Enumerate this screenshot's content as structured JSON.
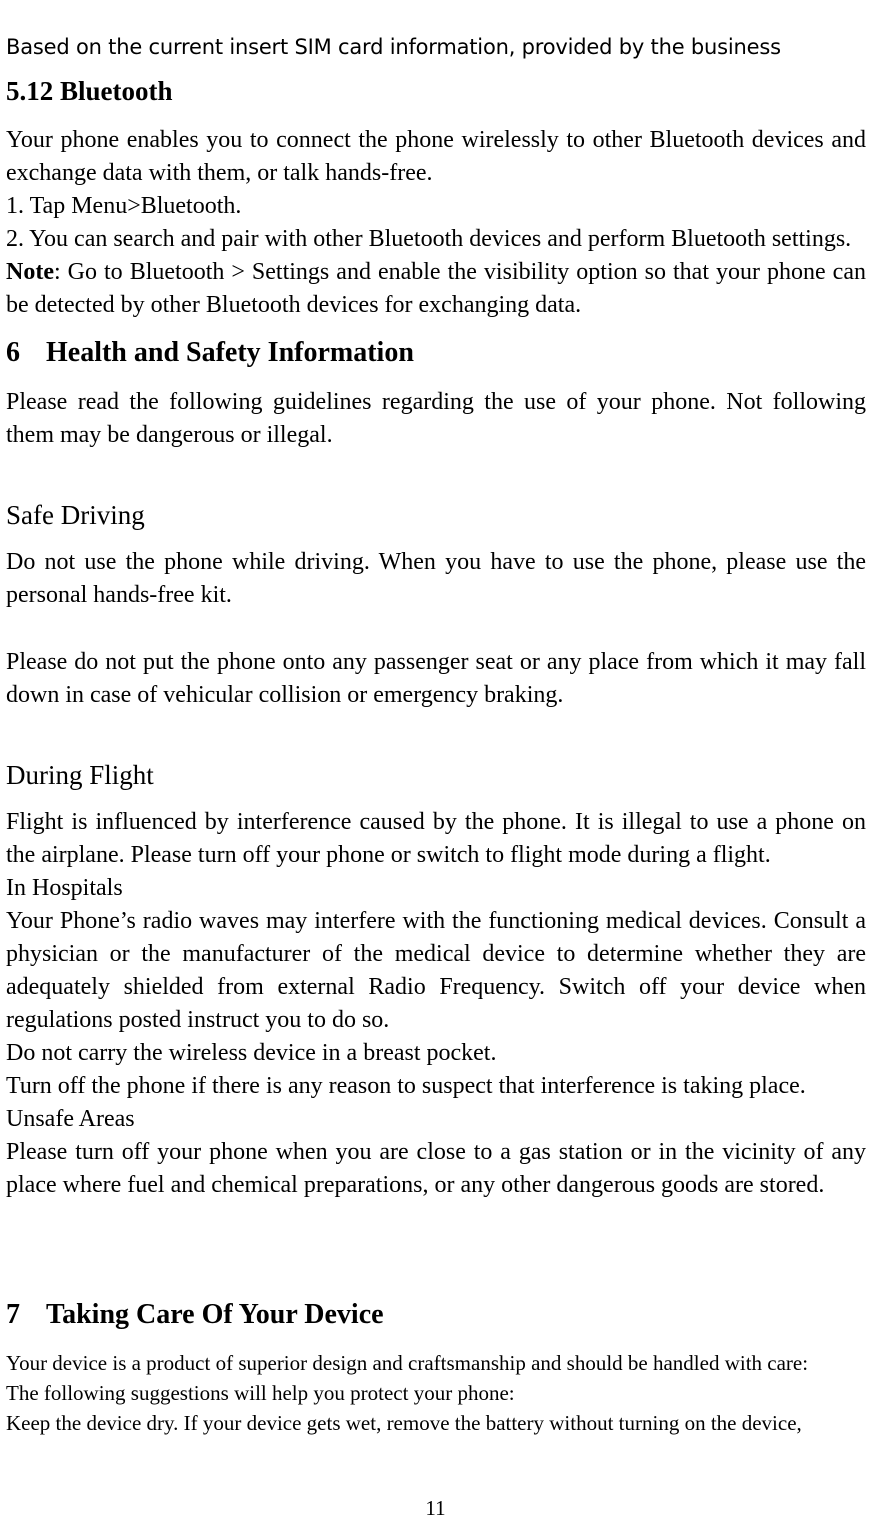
{
  "document": {
    "page_number": "11",
    "running_header": "Based on the current insert SIM card information, provided by the business"
  },
  "bluetooth_section": {
    "heading": "5.12 Bluetooth",
    "intro": "Your phone enables you to connect the phone wirelessly to other Bluetooth devices and exchange data with them, or talk hands-free.",
    "steps": [
      "1. Tap Menu>Bluetooth.",
      "2. You can search and pair with other Bluetooth devices and perform Bluetooth settings."
    ],
    "note_label": "Note",
    "note_text": ": Go to Bluetooth > Settings and enable the visibility option so that your phone can be detected by other Bluetooth devices for exchanging data."
  },
  "health_section": {
    "number": "6",
    "title": "Health and Safety Information",
    "intro": "Please read the following guidelines regarding the use of your phone. Not following them may be dangerous or illegal.",
    "safe_driving": {
      "heading": "Safe Driving",
      "paragraphs": [
        "Do not use the phone while driving. When you have to use the phone, please use the personal hands-free kit.",
        "Please do not put the phone onto any passenger seat or any place from which it may fall down in case of vehicular collision or emergency braking."
      ]
    },
    "during_flight": {
      "heading": "During Flight",
      "lines": [
        "Flight is influenced by interference caused by the phone. It is illegal to use a phone on the airplane. Please turn off your phone or switch to flight mode during a flight.",
        "In Hospitals",
        "Your Phone’s radio waves may interfere with the functioning medical devices. Consult a physician or the manufacturer of the medical device to determine whether they are adequately shielded from external Radio Frequency. Switch off your device when regulations posted instruct you to do so.",
        "Do not carry the wireless device in a breast pocket.",
        "Turn off the phone if there is any reason to suspect that interference is taking place.",
        "Unsafe Areas",
        "Please turn off your phone when you are close to a gas station or in the vicinity of any place where fuel and chemical preparations, or any other dangerous goods are stored."
      ]
    }
  },
  "care_section": {
    "number": "7",
    "title": "Taking Care Of Your Device",
    "lines": [
      "Your device is a product of superior design and craftsmanship and should be handled with care: ",
      "The following suggestions will help you protect your phone: ",
      "Keep the device dry. If your device gets wet, remove the battery without turning on the device, "
    ]
  }
}
